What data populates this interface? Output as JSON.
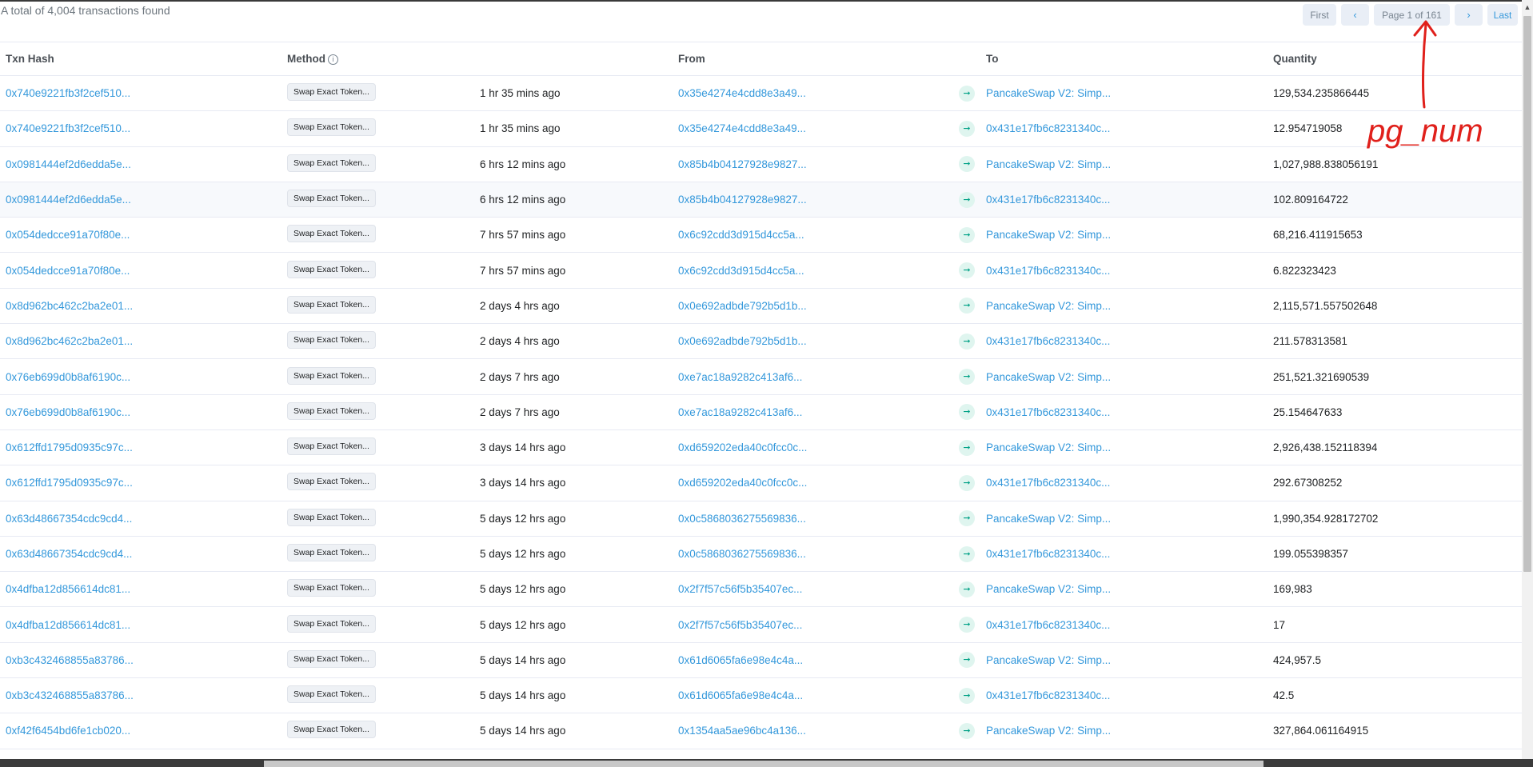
{
  "summary": "A total of 4,004 transactions found",
  "pager": {
    "first": "First",
    "prev": "‹",
    "page": "Page 1 of 161",
    "next": "›",
    "last": "Last"
  },
  "annotation": {
    "label": "pg_num",
    "color": "#e0201b"
  },
  "columns": {
    "hash": "Txn Hash",
    "method": "Method",
    "age": "",
    "from": "From",
    "to": "To",
    "quantity": "Quantity"
  },
  "colors": {
    "link": "#3498db",
    "arrow_bg": "#dff5ef",
    "arrow_fg": "#00a186"
  },
  "rows": [
    {
      "hash": "0x740e9221fb3f2cef510...",
      "method": "Swap Exact Token...",
      "age": "1 hr 35 mins ago",
      "from": "0x35e4274e4cdd8e3a49...",
      "to": "PancakeSwap V2: Simp...",
      "qty": "129,534.235866445"
    },
    {
      "hash": "0x740e9221fb3f2cef510...",
      "method": "Swap Exact Token...",
      "age": "1 hr 35 mins ago",
      "from": "0x35e4274e4cdd8e3a49...",
      "to": "0x431e17fb6c8231340c...",
      "qty": "12.954719058"
    },
    {
      "hash": "0x0981444ef2d6edda5e...",
      "method": "Swap Exact Token...",
      "age": "6 hrs 12 mins ago",
      "from": "0x85b4b04127928e9827...",
      "to": "PancakeSwap V2: Simp...",
      "qty": "1,027,988.838056191"
    },
    {
      "hash": "0x0981444ef2d6edda5e...",
      "method": "Swap Exact Token...",
      "age": "6 hrs 12 mins ago",
      "from": "0x85b4b04127928e9827...",
      "to": "0x431e17fb6c8231340c...",
      "qty": "102.809164722"
    },
    {
      "hash": "0x054dedcce91a70f80e...",
      "method": "Swap Exact Token...",
      "age": "7 hrs 57 mins ago",
      "from": "0x6c92cdd3d915d4cc5a...",
      "to": "PancakeSwap V2: Simp...",
      "qty": "68,216.411915653"
    },
    {
      "hash": "0x054dedcce91a70f80e...",
      "method": "Swap Exact Token...",
      "age": "7 hrs 57 mins ago",
      "from": "0x6c92cdd3d915d4cc5a...",
      "to": "0x431e17fb6c8231340c...",
      "qty": "6.822323423"
    },
    {
      "hash": "0x8d962bc462c2ba2e01...",
      "method": "Swap Exact Token...",
      "age": "2 days 4 hrs ago",
      "from": "0x0e692adbde792b5d1b...",
      "to": "PancakeSwap V2: Simp...",
      "qty": "2,115,571.557502648"
    },
    {
      "hash": "0x8d962bc462c2ba2e01...",
      "method": "Swap Exact Token...",
      "age": "2 days 4 hrs ago",
      "from": "0x0e692adbde792b5d1b...",
      "to": "0x431e17fb6c8231340c...",
      "qty": "211.578313581"
    },
    {
      "hash": "0x76eb699d0b8af6190c...",
      "method": "Swap Exact Token...",
      "age": "2 days 7 hrs ago",
      "from": "0xe7ac18a9282c413af6...",
      "to": "PancakeSwap V2: Simp...",
      "qty": "251,521.321690539"
    },
    {
      "hash": "0x76eb699d0b8af6190c...",
      "method": "Swap Exact Token...",
      "age": "2 days 7 hrs ago",
      "from": "0xe7ac18a9282c413af6...",
      "to": "0x431e17fb6c8231340c...",
      "qty": "25.154647633"
    },
    {
      "hash": "0x612ffd1795d0935c97c...",
      "method": "Swap Exact Token...",
      "age": "3 days 14 hrs ago",
      "from": "0xd659202eda40c0fcc0c...",
      "to": "PancakeSwap V2: Simp...",
      "qty": "2,926,438.152118394"
    },
    {
      "hash": "0x612ffd1795d0935c97c...",
      "method": "Swap Exact Token...",
      "age": "3 days 14 hrs ago",
      "from": "0xd659202eda40c0fcc0c...",
      "to": "0x431e17fb6c8231340c...",
      "qty": "292.67308252"
    },
    {
      "hash": "0x63d48667354cdc9cd4...",
      "method": "Swap Exact Token...",
      "age": "5 days 12 hrs ago",
      "from": "0x0c5868036275569836...",
      "to": "PancakeSwap V2: Simp...",
      "qty": "1,990,354.928172702"
    },
    {
      "hash": "0x63d48667354cdc9cd4...",
      "method": "Swap Exact Token...",
      "age": "5 days 12 hrs ago",
      "from": "0x0c5868036275569836...",
      "to": "0x431e17fb6c8231340c...",
      "qty": "199.055398357"
    },
    {
      "hash": "0x4dfba12d856614dc81...",
      "method": "Swap Exact Token...",
      "age": "5 days 12 hrs ago",
      "from": "0x2f7f57c56f5b35407ec...",
      "to": "PancakeSwap V2: Simp...",
      "qty": "169,983"
    },
    {
      "hash": "0x4dfba12d856614dc81...",
      "method": "Swap Exact Token...",
      "age": "5 days 12 hrs ago",
      "from": "0x2f7f57c56f5b35407ec...",
      "to": "0x431e17fb6c8231340c...",
      "qty": "17"
    },
    {
      "hash": "0xb3c432468855a83786...",
      "method": "Swap Exact Token...",
      "age": "5 days 14 hrs ago",
      "from": "0x61d6065fa6e98e4c4a...",
      "to": "PancakeSwap V2: Simp...",
      "qty": "424,957.5"
    },
    {
      "hash": "0xb3c432468855a83786...",
      "method": "Swap Exact Token...",
      "age": "5 days 14 hrs ago",
      "from": "0x61d6065fa6e98e4c4a...",
      "to": "0x431e17fb6c8231340c...",
      "qty": "42.5"
    },
    {
      "hash": "0xf42f6454bd6fe1cb020...",
      "method": "Swap Exact Token...",
      "age": "5 days 14 hrs ago",
      "from": "0x1354aa5ae96bc4a136...",
      "to": "PancakeSwap V2: Simp...",
      "qty": "327,864.061164915"
    }
  ]
}
